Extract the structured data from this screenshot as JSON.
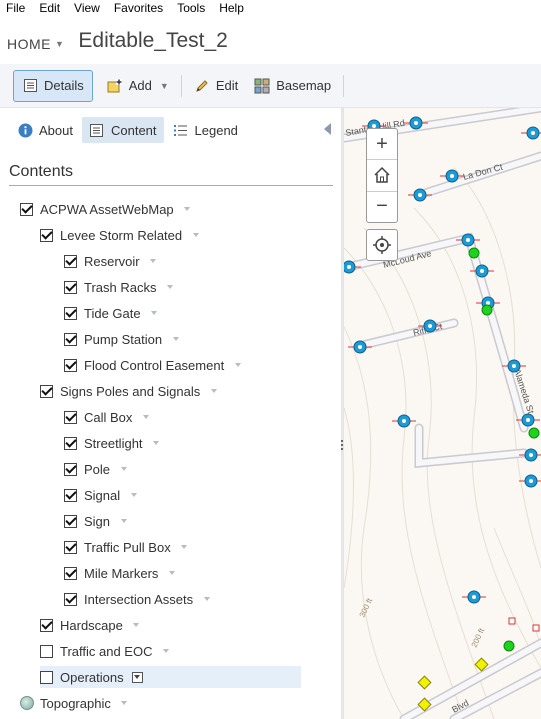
{
  "menu": [
    "File",
    "Edit",
    "View",
    "Favorites",
    "Tools",
    "Help"
  ],
  "header": {
    "home_label": "HOME",
    "map_title": "Editable_Test_2"
  },
  "toolbar": {
    "details_label": "Details",
    "add_label": "Add",
    "edit_label": "Edit",
    "basemap_label": "Basemap"
  },
  "panel": {
    "tabs": {
      "about": "About",
      "content": "Content",
      "legend": "Legend"
    },
    "heading": "Contents",
    "layers": [
      {
        "label": "ACPWA AssetWebMap",
        "checked": true,
        "level": 0
      },
      {
        "label": "Levee Storm Related",
        "checked": true,
        "level": 1
      },
      {
        "label": "Reservoir",
        "checked": true,
        "level": 2
      },
      {
        "label": "Trash Racks",
        "checked": true,
        "level": 2
      },
      {
        "label": "Tide Gate",
        "checked": true,
        "level": 2
      },
      {
        "label": "Pump Station",
        "checked": true,
        "level": 2
      },
      {
        "label": "Flood Control Easement",
        "checked": true,
        "level": 2
      },
      {
        "label": "Signs Poles and Signals",
        "checked": true,
        "level": 1
      },
      {
        "label": "Call Box",
        "checked": true,
        "level": 2
      },
      {
        "label": "Streetlight",
        "checked": true,
        "level": 2
      },
      {
        "label": "Pole",
        "checked": true,
        "level": 2
      },
      {
        "label": "Signal",
        "checked": true,
        "level": 2
      },
      {
        "label": "Sign",
        "checked": true,
        "level": 2
      },
      {
        "label": "Traffic Pull Box",
        "checked": true,
        "level": 2
      },
      {
        "label": "Mile Markers",
        "checked": true,
        "level": 2
      },
      {
        "label": "Intersection Assets",
        "checked": true,
        "level": 2
      },
      {
        "label": "Hardscape",
        "checked": true,
        "level": 1
      },
      {
        "label": "Traffic and EOC",
        "checked": false,
        "level": 1
      },
      {
        "label": "Operations",
        "checked": false,
        "level": 1,
        "highlighted": true
      }
    ],
    "basemap_layer": "Topographic"
  },
  "map": {
    "streets": [
      "Stanton Hill Rd",
      "La Don Ct",
      "McLoud Ave",
      "Rifle Ct",
      "Alameda St",
      "Blvd"
    ],
    "contours": [
      "300 ft",
      "200 ft"
    ],
    "zoom_in": "+",
    "zoom_out": "−"
  },
  "colors": {
    "accent": "#1a8cd8",
    "asset_marker": "#1d9bd6",
    "green_marker": "#1fd21f",
    "yellow_marker": "#f2f200",
    "active_button_bg": "#d7e7f7"
  }
}
